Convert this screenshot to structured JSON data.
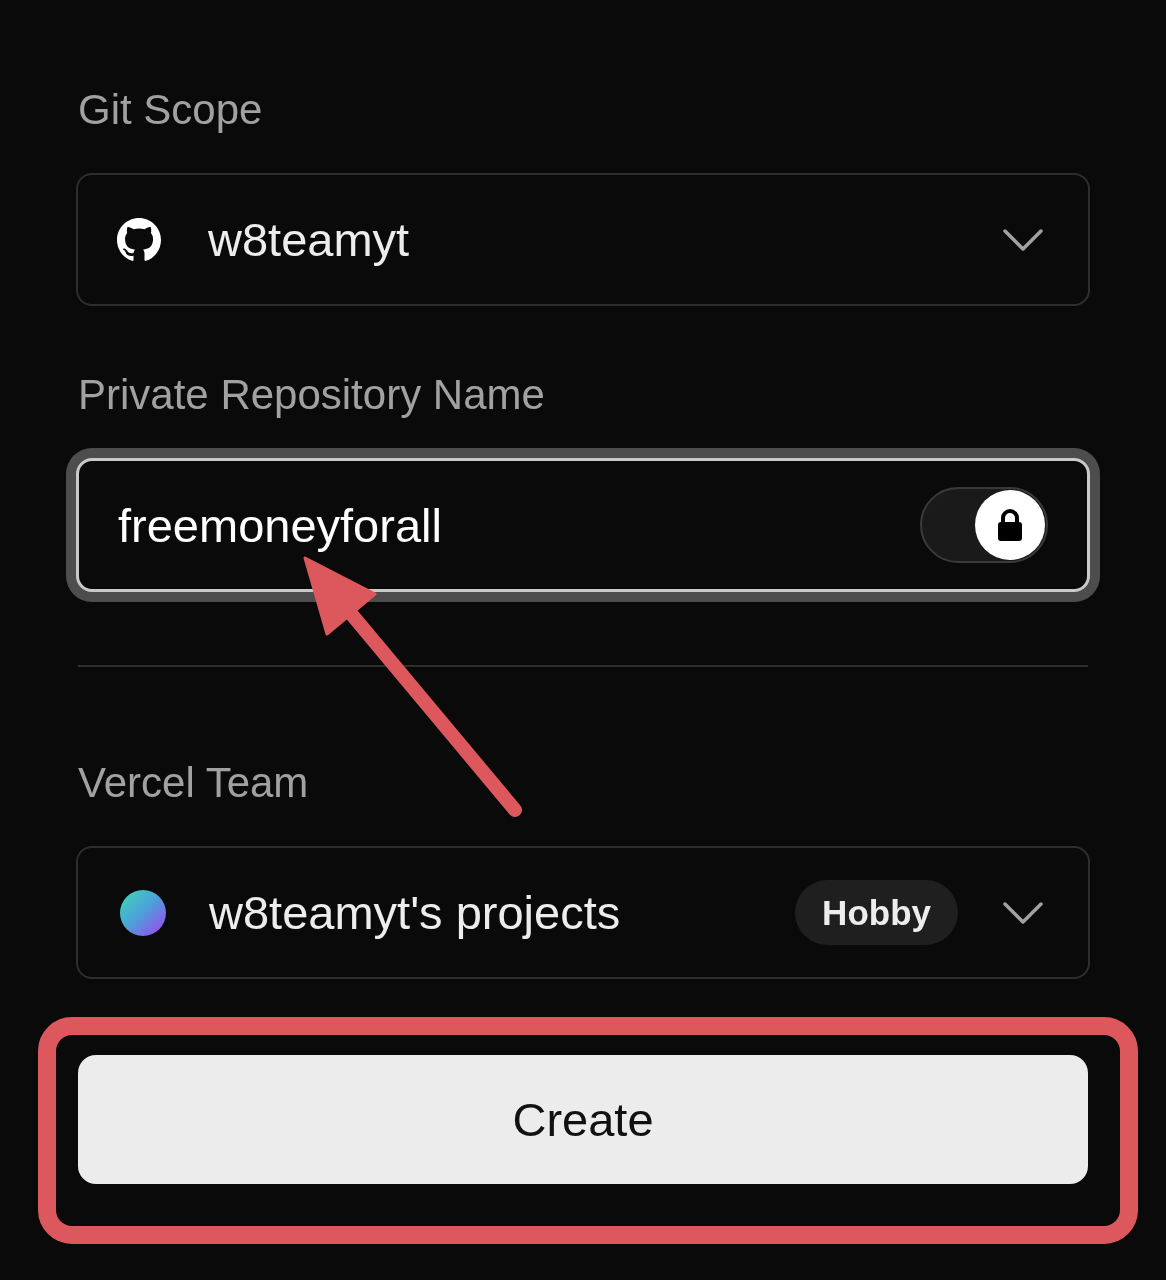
{
  "git_scope": {
    "label": "Git Scope",
    "value": "w8teamyt"
  },
  "repository": {
    "label": "Private Repository Name",
    "value": "freemoneyforall",
    "focused": true,
    "private": true,
    "pointer_arrow": true
  },
  "vercel_team": {
    "label": "Vercel Team",
    "value": "w8teamyt's projects",
    "plan": "Hobby"
  },
  "create_button": {
    "label": "Create",
    "outlined": true
  }
}
